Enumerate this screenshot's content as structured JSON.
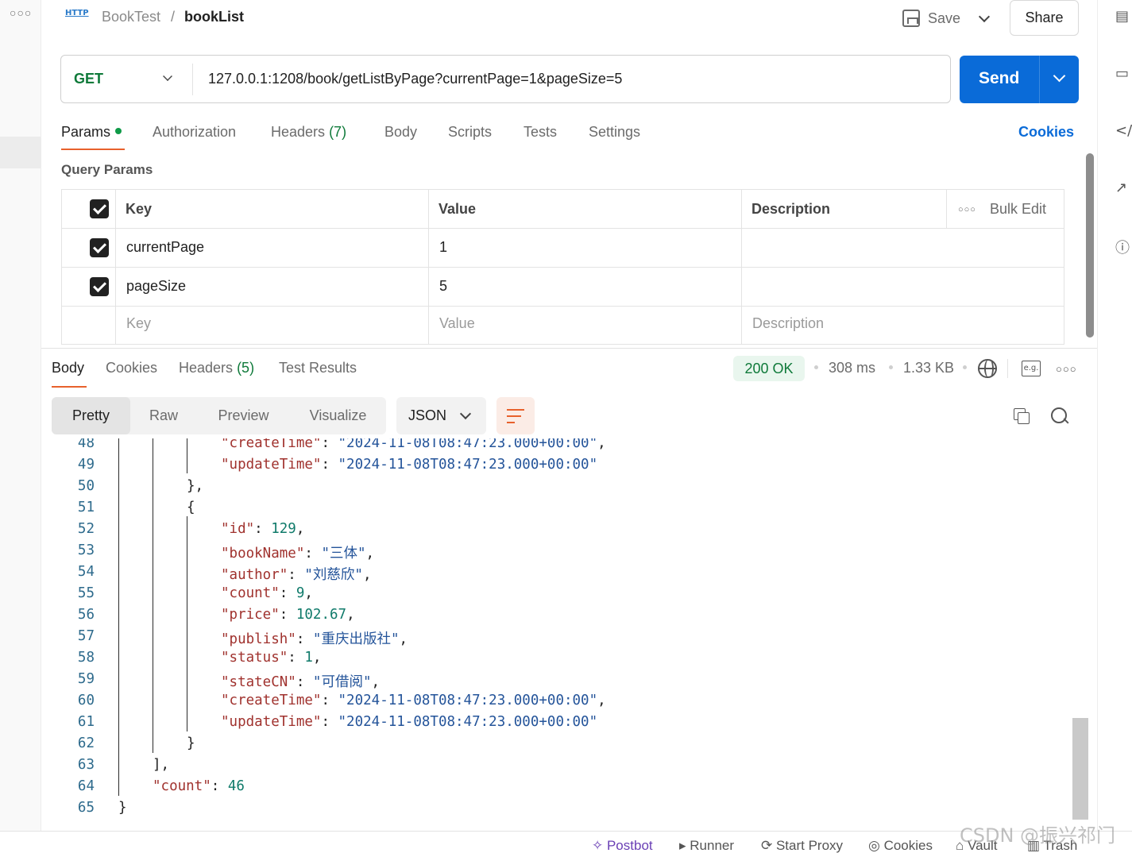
{
  "header": {
    "collection": "BookTest",
    "separator": "/",
    "request_name": "bookList",
    "save_label": "Save",
    "share_label": "Share"
  },
  "request": {
    "method": "GET",
    "url": "127.0.0.1:1208/book/getListByPage?currentPage=1&pageSize=5",
    "send_label": "Send"
  },
  "request_tabs": [
    {
      "label": "Params"
    },
    {
      "label": "Authorization"
    },
    {
      "label": "Headers",
      "count": "(7)"
    },
    {
      "label": "Body"
    },
    {
      "label": "Scripts"
    },
    {
      "label": "Tests"
    },
    {
      "label": "Settings"
    }
  ],
  "cookies_link": "Cookies",
  "query_params": {
    "title": "Query Params",
    "columns": [
      "Key",
      "Value",
      "Description"
    ],
    "bulk_edit": "Bulk Edit",
    "rows": [
      {
        "key": "currentPage",
        "value": "1",
        "description": ""
      },
      {
        "key": "pageSize",
        "value": "5",
        "description": ""
      }
    ],
    "placeholders": {
      "key": "Key",
      "value": "Value",
      "description": "Description"
    }
  },
  "response_tabs": [
    {
      "label": "Body"
    },
    {
      "label": "Cookies"
    },
    {
      "label": "Headers",
      "count": "(5)"
    },
    {
      "label": "Test Results"
    }
  ],
  "response_meta": {
    "status": "200 OK",
    "time": "308 ms",
    "size": "1.33 KB",
    "example_label": "e.g."
  },
  "view_options": [
    "Pretty",
    "Raw",
    "Preview",
    "Visualize"
  ],
  "format": "JSON",
  "code_lines": [
    {
      "n": "48",
      "ind": 2,
      "t": [
        [
          "k",
          "\"createTime\""
        ],
        [
          "p",
          ": "
        ],
        [
          "s",
          "\"2024-11-08T08:47:23.000+00:00\""
        ],
        [
          "p",
          ","
        ]
      ]
    },
    {
      "n": "49",
      "ind": 2,
      "t": [
        [
          "k",
          "\"updateTime\""
        ],
        [
          "p",
          ": "
        ],
        [
          "s",
          "\"2024-11-08T08:47:23.000+00:00\""
        ]
      ]
    },
    {
      "n": "50",
      "ind": 1,
      "t": [
        [
          "p",
          "},"
        ]
      ]
    },
    {
      "n": "51",
      "ind": 1,
      "t": [
        [
          "p",
          "{"
        ]
      ]
    },
    {
      "n": "52",
      "ind": 2,
      "t": [
        [
          "k",
          "\"id\""
        ],
        [
          "p",
          ": "
        ],
        [
          "n",
          "129"
        ],
        [
          "p",
          ","
        ]
      ]
    },
    {
      "n": "53",
      "ind": 2,
      "t": [
        [
          "k",
          "\"bookName\""
        ],
        [
          "p",
          ": "
        ],
        [
          "s",
          "\"三体\""
        ],
        [
          "p",
          ","
        ]
      ]
    },
    {
      "n": "54",
      "ind": 2,
      "t": [
        [
          "k",
          "\"author\""
        ],
        [
          "p",
          ": "
        ],
        [
          "s",
          "\"刘慈欣\""
        ],
        [
          "p",
          ","
        ]
      ]
    },
    {
      "n": "55",
      "ind": 2,
      "t": [
        [
          "k",
          "\"count\""
        ],
        [
          "p",
          ": "
        ],
        [
          "n",
          "9"
        ],
        [
          "p",
          ","
        ]
      ]
    },
    {
      "n": "56",
      "ind": 2,
      "t": [
        [
          "k",
          "\"price\""
        ],
        [
          "p",
          ": "
        ],
        [
          "n",
          "102.67"
        ],
        [
          "p",
          ","
        ]
      ]
    },
    {
      "n": "57",
      "ind": 2,
      "t": [
        [
          "k",
          "\"publish\""
        ],
        [
          "p",
          ": "
        ],
        [
          "s",
          "\"重庆出版社\""
        ],
        [
          "p",
          ","
        ]
      ]
    },
    {
      "n": "58",
      "ind": 2,
      "t": [
        [
          "k",
          "\"status\""
        ],
        [
          "p",
          ": "
        ],
        [
          "n",
          "1"
        ],
        [
          "p",
          ","
        ]
      ]
    },
    {
      "n": "59",
      "ind": 2,
      "t": [
        [
          "k",
          "\"stateCN\""
        ],
        [
          "p",
          ": "
        ],
        [
          "s",
          "\"可借阅\""
        ],
        [
          "p",
          ","
        ]
      ]
    },
    {
      "n": "60",
      "ind": 2,
      "t": [
        [
          "k",
          "\"createTime\""
        ],
        [
          "p",
          ": "
        ],
        [
          "s",
          "\"2024-11-08T08:47:23.000+00:00\""
        ],
        [
          "p",
          ","
        ]
      ]
    },
    {
      "n": "61",
      "ind": 2,
      "t": [
        [
          "k",
          "\"updateTime\""
        ],
        [
          "p",
          ": "
        ],
        [
          "s",
          "\"2024-11-08T08:47:23.000+00:00\""
        ]
      ]
    },
    {
      "n": "62",
      "ind": 1,
      "t": [
        [
          "p",
          "}"
        ]
      ]
    },
    {
      "n": "63",
      "ind": 0,
      "t": [
        [
          "p",
          "],"
        ]
      ]
    },
    {
      "n": "64",
      "ind": 0,
      "t": [
        [
          "k",
          "\"count\""
        ],
        [
          "p",
          ": "
        ],
        [
          "n",
          "46"
        ]
      ]
    },
    {
      "n": "65",
      "ind": -1,
      "t": [
        [
          "p",
          "}"
        ]
      ]
    }
  ],
  "footer": {
    "items": [
      "Postbot",
      "Runner",
      "Start Proxy",
      "Cookies",
      "Vault",
      "Trash"
    ],
    "watermark": "CSDN @振兴祁门"
  },
  "icons": [
    "more-icon",
    "http-icon",
    "save-icon",
    "chevron-down-icon",
    "globe-icon",
    "example-icon",
    "wrap-icon",
    "copy-icon",
    "search-icon",
    "docs-icon",
    "comments-icon",
    "code-icon",
    "related-icon",
    "info-icon"
  ]
}
